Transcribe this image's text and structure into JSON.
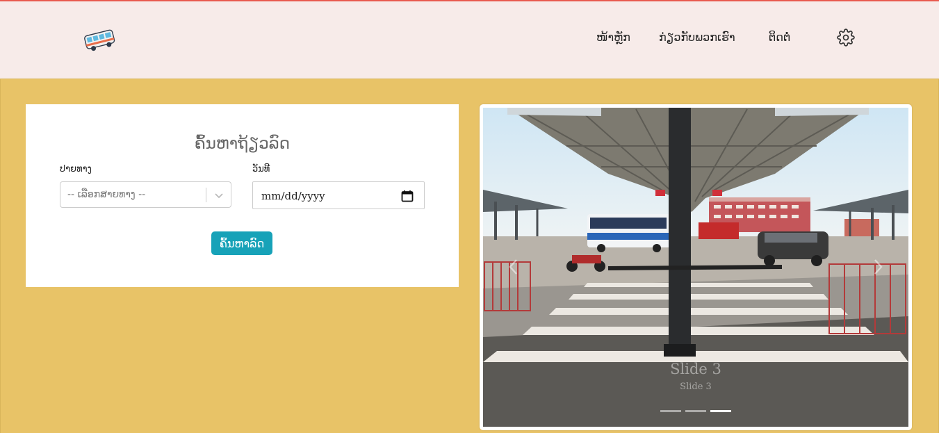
{
  "navbar": {
    "logo_icon": "bus-icon",
    "links": [
      {
        "label": "ໜ້າຫຼັກ"
      },
      {
        "label": "ກ່ຽວກັບພວກເຮົາ"
      },
      {
        "label": "ຕິດຕໍ່"
      }
    ],
    "settings_icon": "gear-icon"
  },
  "search": {
    "title": "ຄົ້ນຫາຖ້ຽວລົດ",
    "route_label": "ປາຍທາງ",
    "route_placeholder": "-- ເລືອກສາຍທາງ --",
    "date_label": "ວັນທີ",
    "date_placeholder": "mm/dd/yyyy",
    "button_label": "ຄົ້ນຫາລົດ"
  },
  "carousel": {
    "caption_title": "Slide 3",
    "caption_text": "Slide 3",
    "slide_count": 3,
    "active_index": 2
  },
  "colors": {
    "navbar_bg": "#f7ebe9",
    "main_bg": "#e8c367",
    "accent_line": "#e85a4f",
    "button_bg": "#17a2b8"
  }
}
